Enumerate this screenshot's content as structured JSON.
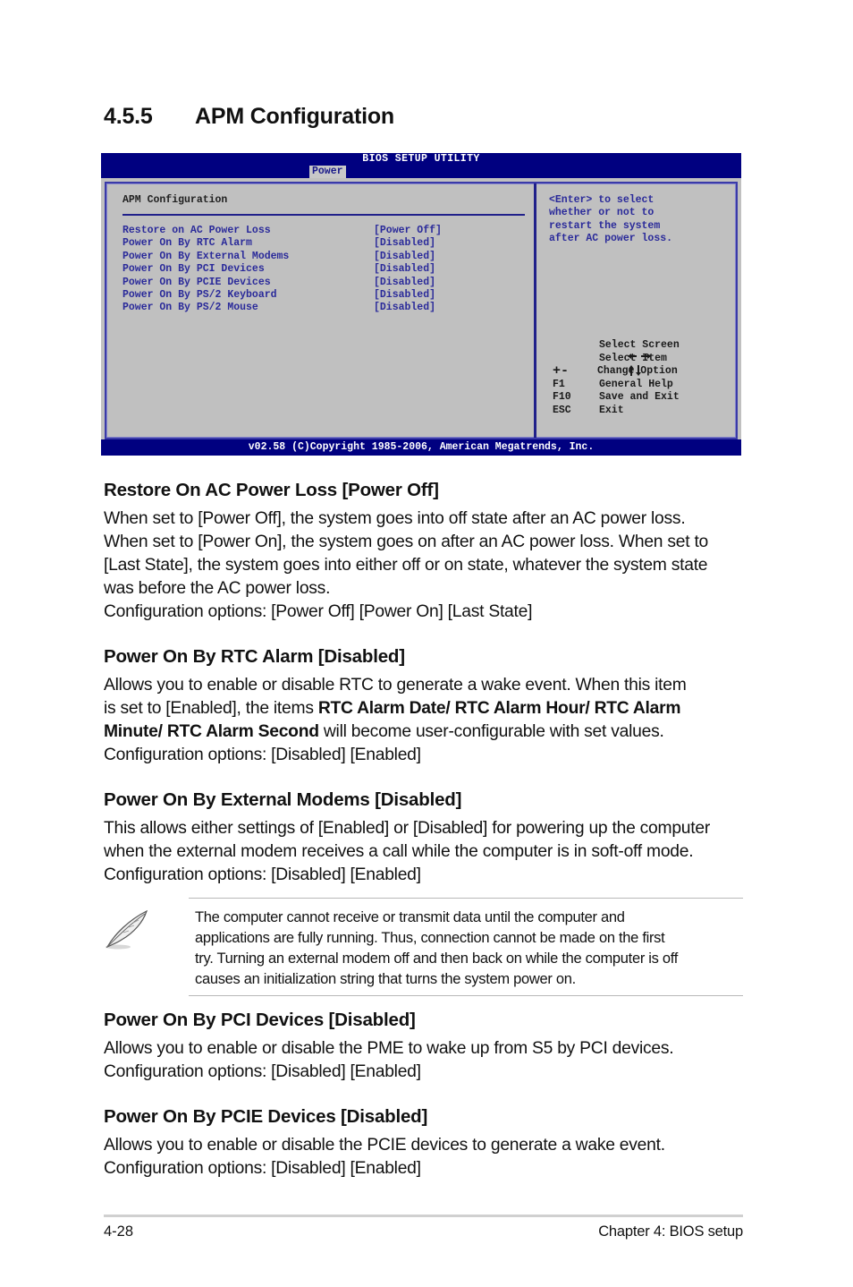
{
  "section": {
    "number": "4.5.5",
    "title": "APM Configuration"
  },
  "bios": {
    "title": "BIOS SETUP UTILITY",
    "active_tab": "Power",
    "heading": "APM Configuration",
    "items": [
      {
        "label": "Restore on AC Power Loss",
        "value": "[Power Off]"
      },
      {
        "label": "Power On By RTC Alarm",
        "value": "[Disabled]"
      },
      {
        "label": "Power On By External Modems",
        "value": "[Disabled]"
      },
      {
        "label": "Power On By PCI Devices",
        "value": "[Disabled]"
      },
      {
        "label": "Power On By PCIE Devices",
        "value": "[Disabled]"
      },
      {
        "label": "Power On By PS/2 Keyboard",
        "value": "[Disabled]"
      },
      {
        "label": "Power On By PS/2 Mouse",
        "value": "[Disabled]"
      }
    ],
    "help_lines": [
      "<Enter> to select",
      "whether or not to",
      "restart the system",
      "after AC power loss."
    ],
    "keys": [
      {
        "key": "left-right-arrows",
        "desc": "Select Screen"
      },
      {
        "key": "up-down-arrows",
        "desc": "Select Item"
      },
      {
        "key": "+-",
        "desc": "Change Option"
      },
      {
        "key": "F1",
        "desc": "General Help"
      },
      {
        "key": "F10",
        "desc": "Save and Exit"
      },
      {
        "key": "ESC",
        "desc": "Exit"
      }
    ],
    "footer": "v02.58 (C)Copyright 1985-2006, American Megatrends, Inc.",
    "colors": {
      "bar": "#000080",
      "panel": "#c0c0c0",
      "text": "#2a2a9a"
    }
  },
  "sections": [
    {
      "heading": "Restore On AC Power Loss [Power Off]",
      "lines": [
        "When set to [Power Off], the system goes into off state after an AC power loss.",
        "When set to [Power On], the system goes on after an AC power loss. When set to",
        "[Last State], the system goes into either off or on state, whatever the system state",
        "was before the AC power loss.",
        "Configuration options: [Power Off] [Power On] [Last State]"
      ]
    },
    {
      "heading": "Power On By RTC Alarm [Disabled]",
      "line1": "Allows you to enable or disable RTC to generate a wake event. When this item",
      "line2_pre": "is set to [Enabled], the items ",
      "line2_bold": "RTC Alarm Date/ RTC Alarm Hour/ RTC Alarm",
      "line3_bold": "Minute/ RTC Alarm Second",
      "line3_post": " will become user-configurable with set values.",
      "line4": "Configuration options: [Disabled] [Enabled]"
    },
    {
      "heading": "Power On By External Modems [Disabled]",
      "lines": [
        "This allows either settings of [Enabled] or [Disabled] for powering up the computer",
        "when the external modem receives a call while the computer is in soft-off mode.",
        "Configuration options: [Disabled] [Enabled]"
      ]
    },
    {
      "heading": "Power On By PCI Devices [Disabled]",
      "lines": [
        "Allows you to enable or disable the PME to wake up from S5 by PCI devices.",
        "Configuration options: [Disabled] [Enabled]"
      ]
    },
    {
      "heading": "Power On By PCIE Devices [Disabled]",
      "lines": [
        "Allows you to enable or disable the PCIE devices to generate a wake event.",
        "Configuration options: [Disabled] [Enabled]"
      ]
    }
  ],
  "note": {
    "icon": "feather-pen-icon",
    "lines": [
      "The computer cannot receive or transmit data until the computer and",
      "applications are fully running. Thus, connection cannot be made on the first",
      "try. Turning an external modem off and then back on while the computer is off",
      "causes an initialization string that turns the system power on."
    ]
  },
  "footer": {
    "page": "4-28",
    "chapter": "Chapter 4: BIOS setup"
  }
}
